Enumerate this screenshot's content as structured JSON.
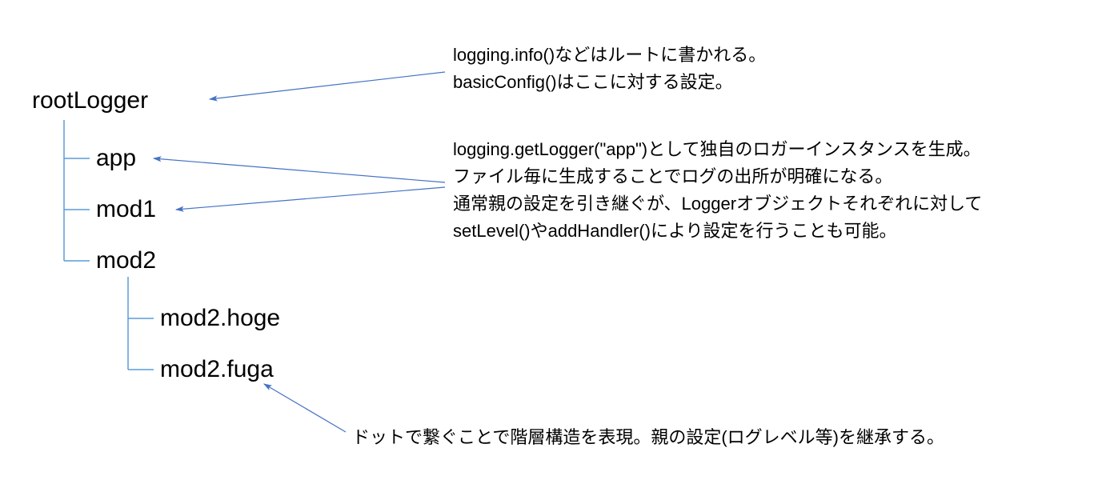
{
  "tree": {
    "root": "rootLogger",
    "children": [
      {
        "label": "app"
      },
      {
        "label": "mod1"
      },
      {
        "label": "mod2",
        "children": [
          {
            "label": "mod2.hoge"
          },
          {
            "label": "mod2.fuga"
          }
        ]
      }
    ]
  },
  "annotations": {
    "root": {
      "line1": "logging.info()などはルートに書かれる。",
      "line2": "basicConfig()はここに対する設定。"
    },
    "getLogger": {
      "line1": "logging.getLogger(\"app\")として独自のロガーインスタンスを生成。",
      "line2": "ファイル毎に生成することでログの出所が明確になる。",
      "line3": "通常親の設定を引き継ぐが、Loggerオブジェクトそれぞれに対して",
      "line4": "setLevel()やaddHandler()により設定を行うことも可能。"
    },
    "dot": {
      "line1": "ドットで繋ぐことで階層構造を表現。親の設定(ログレベル等)を継承する。"
    }
  }
}
